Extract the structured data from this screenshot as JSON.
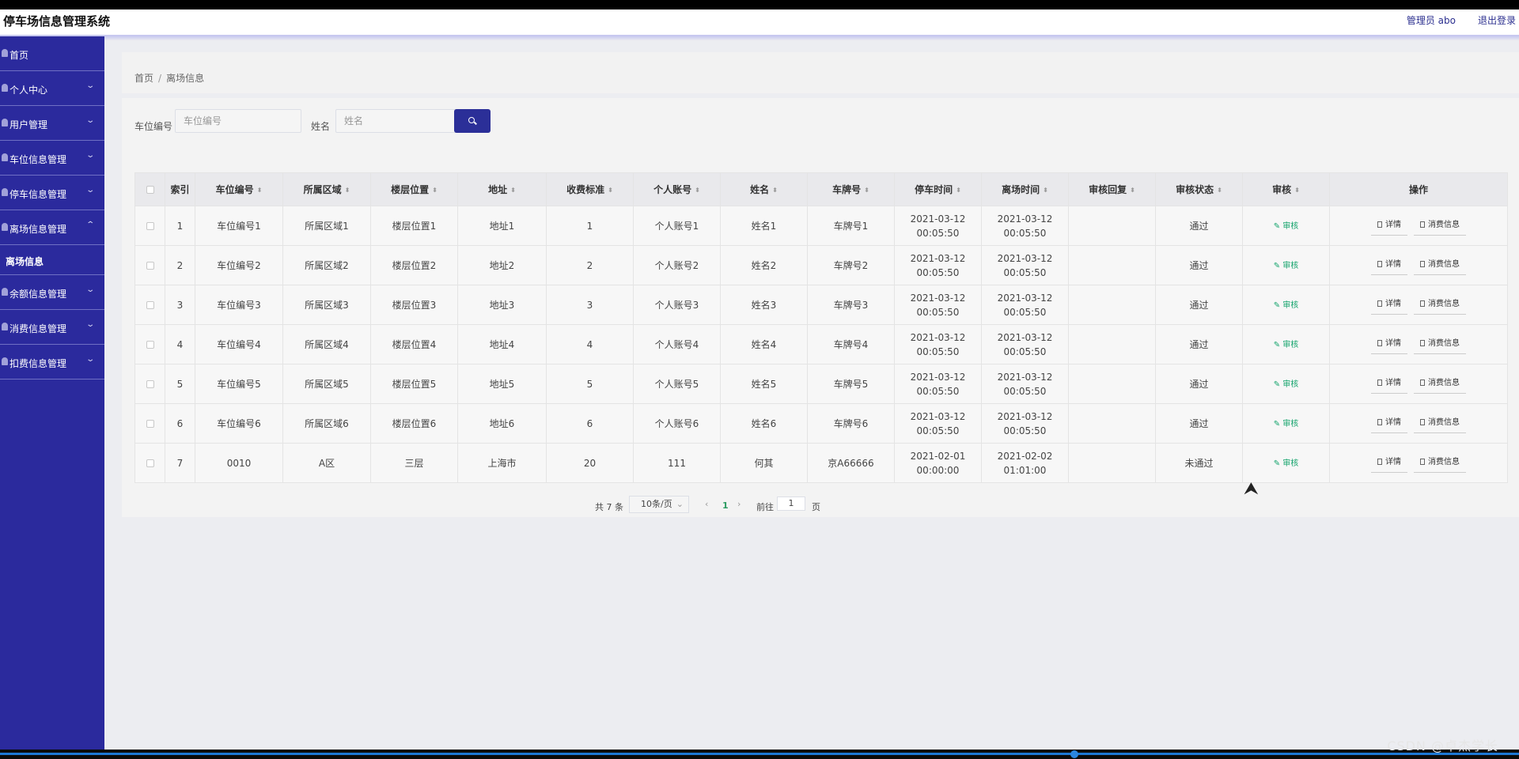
{
  "app": {
    "title": "停车场信息管理系统",
    "admin_label": "管理员 abo",
    "logout_label": "退出登录"
  },
  "sidebar": {
    "items": [
      {
        "label": "首页",
        "icon": "home-icon",
        "chevron": ""
      },
      {
        "label": "个人中心",
        "icon": "user-icon",
        "chevron": "⌄"
      },
      {
        "label": "用户管理",
        "icon": "users-icon",
        "chevron": "⌄"
      },
      {
        "label": "车位信息管理",
        "icon": "parking-icon",
        "chevron": "⌄"
      },
      {
        "label": "停车信息管理",
        "icon": "car-icon",
        "chevron": "⌄"
      },
      {
        "label": "离场信息管理",
        "icon": "exit-icon",
        "chevron": "⌃"
      },
      {
        "label": "余额信息管理",
        "icon": "wallet-icon",
        "chevron": "⌄"
      },
      {
        "label": "消费信息管理",
        "icon": "receipt-icon",
        "chevron": "⌄"
      },
      {
        "label": "扣费信息管理",
        "icon": "deduct-icon",
        "chevron": "⌄"
      }
    ],
    "sub_item": "离场信息"
  },
  "breadcrumb": {
    "home": "首页",
    "sep": "/",
    "current": "离场信息"
  },
  "search": {
    "space_label": "车位编号",
    "space_placeholder": "车位编号",
    "name_label": "姓名",
    "name_placeholder": "姓名"
  },
  "table": {
    "headers": [
      "索引",
      "车位编号",
      "所属区域",
      "楼层位置",
      "地址",
      "收费标准",
      "个人账号",
      "姓名",
      "车牌号",
      "停车时间",
      "离场时间",
      "审核回复",
      "审核状态",
      "审核",
      "操作"
    ],
    "rows": [
      [
        "1",
        "车位编号1",
        "所属区域1",
        "楼层位置1",
        "地址1",
        "1",
        "个人账号1",
        "姓名1",
        "车牌号1",
        "2021-03-12 00:05:50",
        "2021-03-12 00:05:50",
        "",
        "通过"
      ],
      [
        "2",
        "车位编号2",
        "所属区域2",
        "楼层位置2",
        "地址2",
        "2",
        "个人账号2",
        "姓名2",
        "车牌号2",
        "2021-03-12 00:05:50",
        "2021-03-12 00:05:50",
        "",
        "通过"
      ],
      [
        "3",
        "车位编号3",
        "所属区域3",
        "楼层位置3",
        "地址3",
        "3",
        "个人账号3",
        "姓名3",
        "车牌号3",
        "2021-03-12 00:05:50",
        "2021-03-12 00:05:50",
        "",
        "通过"
      ],
      [
        "4",
        "车位编号4",
        "所属区域4",
        "楼层位置4",
        "地址4",
        "4",
        "个人账号4",
        "姓名4",
        "车牌号4",
        "2021-03-12 00:05:50",
        "2021-03-12 00:05:50",
        "",
        "通过"
      ],
      [
        "5",
        "车位编号5",
        "所属区域5",
        "楼层位置5",
        "地址5",
        "5",
        "个人账号5",
        "姓名5",
        "车牌号5",
        "2021-03-12 00:05:50",
        "2021-03-12 00:05:50",
        "",
        "通过"
      ],
      [
        "6",
        "车位编号6",
        "所属区域6",
        "楼层位置6",
        "地址6",
        "6",
        "个人账号6",
        "姓名6",
        "车牌号6",
        "2021-03-12 00:05:50",
        "2021-03-12 00:05:50",
        "",
        "通过"
      ],
      [
        "7",
        "0010",
        "A区",
        "三层",
        "上海市",
        "20",
        "111",
        "何其",
        "京A66666",
        "2021-02-01 00:00:00",
        "2021-02-02 01:01:00",
        "",
        "未通过"
      ]
    ],
    "audit_link": "审核",
    "detail_btn": "详情",
    "consume_btn": "消费信息"
  },
  "pagination": {
    "total": "共 7 条",
    "page_size": "10条/页",
    "prev": "‹",
    "current": "1",
    "next": "›",
    "goto_label": "前往",
    "goto_value": "1",
    "page_unit": "页"
  },
  "watermark": "CSDN @卓杰学长",
  "colors": {
    "sidebar": "#2b2a9d",
    "accent": "#2b2f98",
    "success": "#13a36b"
  }
}
